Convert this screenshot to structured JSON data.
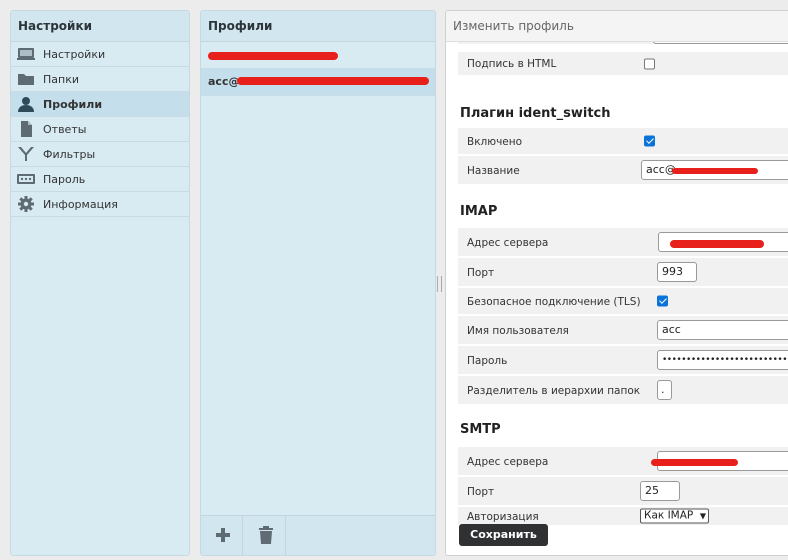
{
  "settings_panel": {
    "title": "Настройки",
    "items": [
      {
        "label": "Настройки",
        "icon": "monitor-icon"
      },
      {
        "label": "Папки",
        "icon": "folder-icon"
      },
      {
        "label": "Профили",
        "icon": "user-icon",
        "selected": true
      },
      {
        "label": "Ответы",
        "icon": "document-icon"
      },
      {
        "label": "Фильтры",
        "icon": "filter-icon"
      },
      {
        "label": "Пароль",
        "icon": "password-icon"
      },
      {
        "label": "Информация",
        "icon": "gear-icon"
      }
    ]
  },
  "profiles_panel": {
    "title": "Профили",
    "items": [
      {
        "label": ""
      },
      {
        "label": "acc@",
        "selected": true
      }
    ]
  },
  "edit_panel": {
    "title": "Изменить профиль",
    "html_signature_label": "Подпись в HTML",
    "html_signature_checked": false,
    "plugin_section": "Плагин ident_switch",
    "enabled_label": "Включено",
    "enabled_checked": true,
    "name_label": "Название",
    "name_value": "acc@",
    "imap_section": "IMAP",
    "imap": {
      "server_label": "Адрес сервера",
      "server_value": "",
      "port_label": "Порт",
      "port_value": "993",
      "tls_label": "Безопасное подключение (TLS)",
      "tls_checked": true,
      "username_label": "Имя пользователя",
      "username_value": "acc",
      "password_label": "Пароль",
      "password_value": "••••••••••••••••••••••••••",
      "delimiter_label": "Разделитель в иерархии папок",
      "delimiter_value": "."
    },
    "smtp_section": "SMTP",
    "smtp": {
      "server_label": "Адрес сервера",
      "server_value": "",
      "port_label": "Порт",
      "port_value": "25",
      "auth_label": "Авторизация",
      "auth_value": "Как IMAP"
    },
    "save_label": "Сохранить"
  },
  "colors": {
    "panel_bg": "#d8ebf3",
    "selected_bg": "#c4dfeb",
    "checkbox_checked": "#0a73d9",
    "redaction": "#e8201c",
    "save_button": "#2f3133"
  }
}
